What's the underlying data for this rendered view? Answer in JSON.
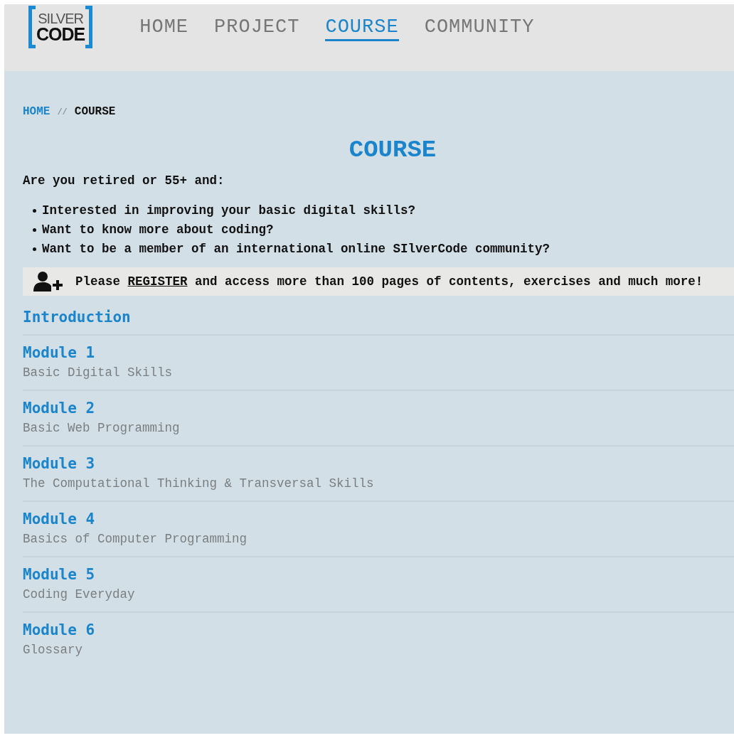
{
  "logo": {
    "top": "SILVER",
    "bottom": "CODE"
  },
  "nav": [
    {
      "label": "HOME",
      "selected": false
    },
    {
      "label": "PROJECT",
      "selected": false
    },
    {
      "label": "COURSE",
      "selected": true
    },
    {
      "label": "COMMUNITY",
      "selected": false
    }
  ],
  "breadcrumb": {
    "items": [
      "HOME",
      "COURSE"
    ],
    "separator": "//"
  },
  "title": "COURSE",
  "intro": "Are you retired or 55+ and:",
  "bullets": [
    "Interested in improving your basic digital skills?",
    "Want to know more about coding?",
    "Want to be a member of an international online SIlverCode community?"
  ],
  "notice": {
    "before": "Please",
    "link": "REGISTER",
    "after": "and access more than 100 pages of contents, exercises and much more!"
  },
  "sections": [
    {
      "title": "Introduction"
    },
    {
      "title": "Module 1",
      "subtitle": "Basic Digital Skills"
    },
    {
      "title": "Module 2",
      "subtitle": "Basic Web Programming"
    },
    {
      "title": "Module 3",
      "subtitle": "The Computational Thinking & Transversal Skills"
    },
    {
      "title": "Module 4",
      "subtitle": "Basics of Computer Programming"
    },
    {
      "title": "Module 5",
      "subtitle": "Coding Everyday"
    },
    {
      "title": "Module 6",
      "subtitle": "Glossary"
    }
  ]
}
